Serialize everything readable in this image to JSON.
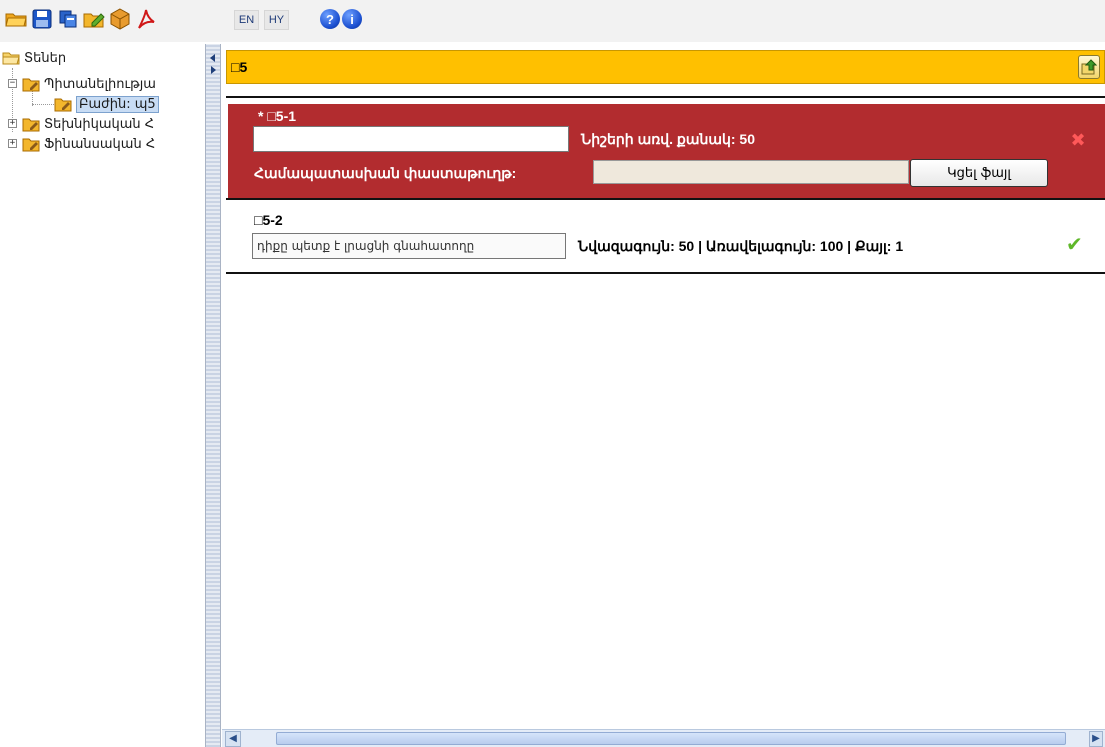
{
  "toolbar": {
    "icons": [
      "open-folder-icon",
      "save-icon",
      "copy-icon",
      "edit-icon",
      "package-icon",
      "pdf-icon"
    ],
    "lang_en": "EN",
    "lang_hy": "HY",
    "help_glyph": "?",
    "info_glyph": "i"
  },
  "tree": {
    "root": "Տեներ",
    "items": [
      {
        "label": "Պիտանելիությա"
      },
      {
        "label": "Բաժին: պ5",
        "selected": true
      },
      {
        "label": "Տեխնիկական Հ"
      },
      {
        "label": "Ֆինանսական Հ"
      }
    ]
  },
  "panel": {
    "title": "□5"
  },
  "item1": {
    "title": "* □5-1",
    "char_limit": "Նիշերի առվ. քանակ: 50",
    "file_label": "Համապատասխան փաստաթուղթ:",
    "browse": "Կցել ֆայլ",
    "status": "invalid",
    "close_glyph": "✖"
  },
  "item2": {
    "title": "□5-2",
    "input_value": "դիքը պետք է լրացնի գնահատողը",
    "constraints": "Նվազագույն: 50 | Առավելագույն: 100 | Քայլ: 1",
    "status": "valid",
    "check_glyph": "✔"
  },
  "colors": {
    "header_bg": "#ffc000",
    "error_bg": "#b22c2f",
    "valid_check": "#5fb82a"
  }
}
